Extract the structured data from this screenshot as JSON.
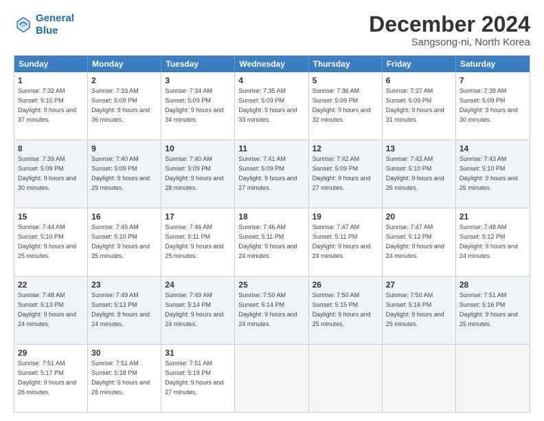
{
  "header": {
    "logo_line1": "General",
    "logo_line2": "Blue",
    "month": "December 2024",
    "location": "Sangsong-ni, North Korea"
  },
  "weekdays": [
    "Sunday",
    "Monday",
    "Tuesday",
    "Wednesday",
    "Thursday",
    "Friday",
    "Saturday"
  ],
  "rows": [
    [
      {
        "num": "1",
        "sunrise": "Sunrise: 7:32 AM",
        "sunset": "Sunset: 5:10 PM",
        "daylight": "Daylight: 9 hours and 37 minutes."
      },
      {
        "num": "2",
        "sunrise": "Sunrise: 7:33 AM",
        "sunset": "Sunset: 5:09 PM",
        "daylight": "Daylight: 9 hours and 36 minutes."
      },
      {
        "num": "3",
        "sunrise": "Sunrise: 7:34 AM",
        "sunset": "Sunset: 5:09 PM",
        "daylight": "Daylight: 9 hours and 34 minutes."
      },
      {
        "num": "4",
        "sunrise": "Sunrise: 7:35 AM",
        "sunset": "Sunset: 5:09 PM",
        "daylight": "Daylight: 9 hours and 33 minutes."
      },
      {
        "num": "5",
        "sunrise": "Sunrise: 7:36 AM",
        "sunset": "Sunset: 5:09 PM",
        "daylight": "Daylight: 9 hours and 32 minutes."
      },
      {
        "num": "6",
        "sunrise": "Sunrise: 7:37 AM",
        "sunset": "Sunset: 5:09 PM",
        "daylight": "Daylight: 9 hours and 31 minutes."
      },
      {
        "num": "7",
        "sunrise": "Sunrise: 7:38 AM",
        "sunset": "Sunset: 5:09 PM",
        "daylight": "Daylight: 9 hours and 30 minutes."
      }
    ],
    [
      {
        "num": "8",
        "sunrise": "Sunrise: 7:39 AM",
        "sunset": "Sunset: 5:09 PM",
        "daylight": "Daylight: 9 hours and 30 minutes."
      },
      {
        "num": "9",
        "sunrise": "Sunrise: 7:40 AM",
        "sunset": "Sunset: 5:09 PM",
        "daylight": "Daylight: 9 hours and 29 minutes."
      },
      {
        "num": "10",
        "sunrise": "Sunrise: 7:40 AM",
        "sunset": "Sunset: 5:09 PM",
        "daylight": "Daylight: 9 hours and 28 minutes."
      },
      {
        "num": "11",
        "sunrise": "Sunrise: 7:41 AM",
        "sunset": "Sunset: 5:09 PM",
        "daylight": "Daylight: 9 hours and 27 minutes."
      },
      {
        "num": "12",
        "sunrise": "Sunrise: 7:42 AM",
        "sunset": "Sunset: 5:09 PM",
        "daylight": "Daylight: 9 hours and 27 minutes."
      },
      {
        "num": "13",
        "sunrise": "Sunrise: 7:43 AM",
        "sunset": "Sunset: 5:10 PM",
        "daylight": "Daylight: 9 hours and 26 minutes."
      },
      {
        "num": "14",
        "sunrise": "Sunrise: 7:43 AM",
        "sunset": "Sunset: 5:10 PM",
        "daylight": "Daylight: 9 hours and 26 minutes."
      }
    ],
    [
      {
        "num": "15",
        "sunrise": "Sunrise: 7:44 AM",
        "sunset": "Sunset: 5:10 PM",
        "daylight": "Daylight: 9 hours and 25 minutes."
      },
      {
        "num": "16",
        "sunrise": "Sunrise: 7:45 AM",
        "sunset": "Sunset: 5:10 PM",
        "daylight": "Daylight: 9 hours and 25 minutes."
      },
      {
        "num": "17",
        "sunrise": "Sunrise: 7:46 AM",
        "sunset": "Sunset: 5:11 PM",
        "daylight": "Daylight: 9 hours and 25 minutes."
      },
      {
        "num": "18",
        "sunrise": "Sunrise: 7:46 AM",
        "sunset": "Sunset: 5:11 PM",
        "daylight": "Daylight: 9 hours and 24 minutes."
      },
      {
        "num": "19",
        "sunrise": "Sunrise: 7:47 AM",
        "sunset": "Sunset: 5:11 PM",
        "daylight": "Daylight: 9 hours and 24 minutes."
      },
      {
        "num": "20",
        "sunrise": "Sunrise: 7:47 AM",
        "sunset": "Sunset: 5:12 PM",
        "daylight": "Daylight: 9 hours and 24 minutes."
      },
      {
        "num": "21",
        "sunrise": "Sunrise: 7:48 AM",
        "sunset": "Sunset: 5:12 PM",
        "daylight": "Daylight: 9 hours and 24 minutes."
      }
    ],
    [
      {
        "num": "22",
        "sunrise": "Sunrise: 7:48 AM",
        "sunset": "Sunset: 5:13 PM",
        "daylight": "Daylight: 9 hours and 24 minutes."
      },
      {
        "num": "23",
        "sunrise": "Sunrise: 7:49 AM",
        "sunset": "Sunset: 5:13 PM",
        "daylight": "Daylight: 9 hours and 24 minutes."
      },
      {
        "num": "24",
        "sunrise": "Sunrise: 7:49 AM",
        "sunset": "Sunset: 5:14 PM",
        "daylight": "Daylight: 9 hours and 24 minutes."
      },
      {
        "num": "25",
        "sunrise": "Sunrise: 7:50 AM",
        "sunset": "Sunset: 5:14 PM",
        "daylight": "Daylight: 9 hours and 24 minutes."
      },
      {
        "num": "26",
        "sunrise": "Sunrise: 7:50 AM",
        "sunset": "Sunset: 5:15 PM",
        "daylight": "Daylight: 9 hours and 25 minutes."
      },
      {
        "num": "27",
        "sunrise": "Sunrise: 7:50 AM",
        "sunset": "Sunset: 5:16 PM",
        "daylight": "Daylight: 9 hours and 25 minutes."
      },
      {
        "num": "28",
        "sunrise": "Sunrise: 7:51 AM",
        "sunset": "Sunset: 5:16 PM",
        "daylight": "Daylight: 9 hours and 25 minutes."
      }
    ],
    [
      {
        "num": "29",
        "sunrise": "Sunrise: 7:51 AM",
        "sunset": "Sunset: 5:17 PM",
        "daylight": "Daylight: 9 hours and 26 minutes."
      },
      {
        "num": "30",
        "sunrise": "Sunrise: 7:51 AM",
        "sunset": "Sunset: 5:18 PM",
        "daylight": "Daylight: 9 hours and 26 minutes."
      },
      {
        "num": "31",
        "sunrise": "Sunrise: 7:51 AM",
        "sunset": "Sunset: 5:19 PM",
        "daylight": "Daylight: 9 hours and 27 minutes."
      },
      null,
      null,
      null,
      null
    ]
  ],
  "row_alts": [
    false,
    true,
    false,
    true,
    false
  ]
}
